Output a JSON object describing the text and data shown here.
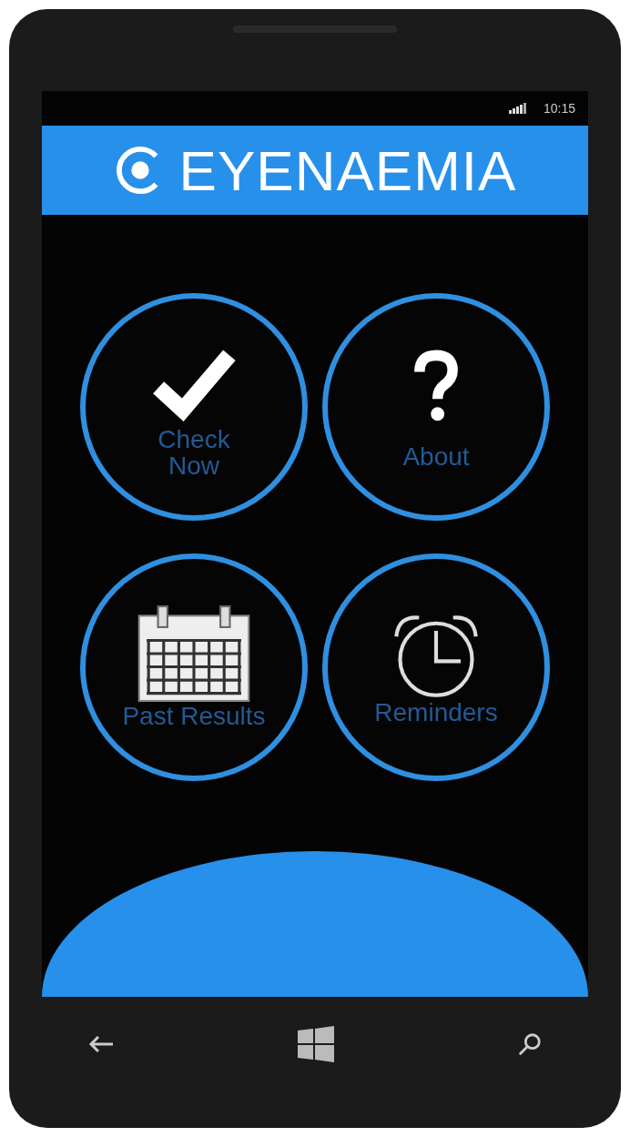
{
  "status_bar": {
    "time": "10:15"
  },
  "header": {
    "title": "EYENAEMIA"
  },
  "tiles": [
    {
      "kind": "check",
      "label": "Check Now"
    },
    {
      "kind": "question",
      "label": "About"
    },
    {
      "kind": "calendar",
      "label": "Past Results"
    },
    {
      "kind": "alarm",
      "label": "Reminders"
    }
  ]
}
